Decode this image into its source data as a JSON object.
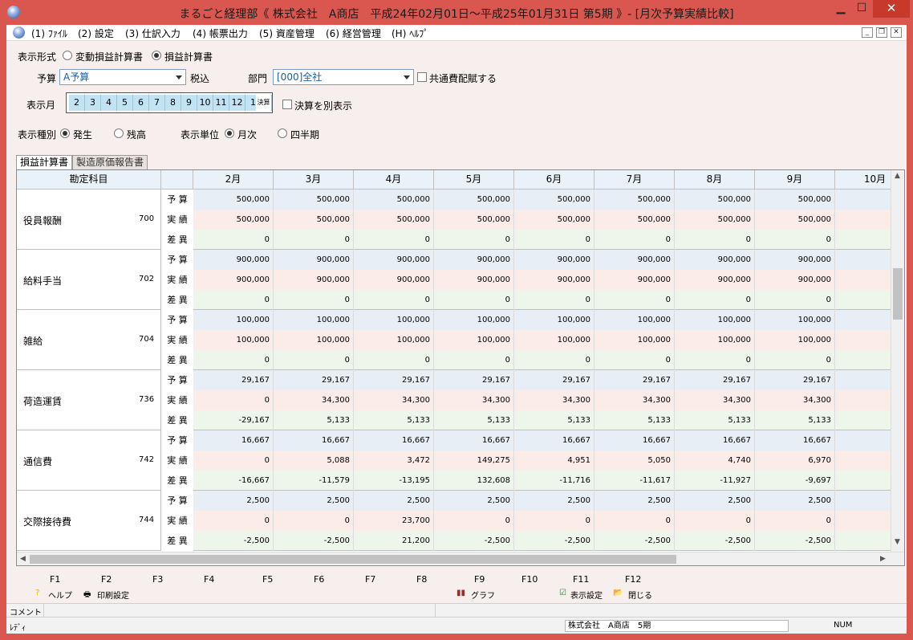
{
  "window": {
    "title": "まるごと経理部《 株式会社　A商店　平成24年02月01日～平成25年01月31日 第5期 》- [月次予算実績比較]",
    "min": "▁",
    "max": "☐",
    "close": "✕"
  },
  "menu": [
    {
      "label": "(1) ﾌｧｲﾙ"
    },
    {
      "label": "(2) 設定"
    },
    {
      "label": "(3) 仕訳入力"
    },
    {
      "label": "(4) 帳票出力"
    },
    {
      "label": "(5) 資産管理"
    },
    {
      "label": "(6) 経営管理"
    },
    {
      "label": "(H) ﾍﾙﾌﾟ"
    }
  ],
  "mdi": {
    "min": "_",
    "restore": "❐",
    "close": "✕"
  },
  "options": {
    "format_label": "表示形式",
    "format_opt1": "変動損益計算書",
    "format_opt2": "損益計算書",
    "format_selected": 2,
    "budget_label": "予算",
    "budget_value": "A予算",
    "tax_label": "税込",
    "dept_label": "部門",
    "dept_value": "[000]全社",
    "common_cost_label": "共通費配賦する",
    "month_label": "表示月",
    "months": [
      "2",
      "3",
      "4",
      "5",
      "6",
      "7",
      "8",
      "9",
      "10",
      "11",
      "12",
      "1"
    ],
    "kessan": "決算",
    "kessan_separate_label": "決算を別表示",
    "kind_label": "表示種別",
    "kind_opt1": "発生",
    "kind_opt2": "残高",
    "unit_label": "表示単位",
    "unit_opt1": "月次",
    "unit_opt2": "四半期"
  },
  "tabs": [
    {
      "label": "損益計算書",
      "active": true
    },
    {
      "label": "製造原価報告書",
      "active": false
    }
  ],
  "table": {
    "header_account": "勘定科目",
    "months": [
      "2月",
      "3月",
      "4月",
      "5月",
      "6月",
      "7月",
      "8月",
      "9月",
      "10月"
    ],
    "row_types": [
      "予 算",
      "実 績",
      "差 異"
    ],
    "accounts": [
      {
        "name": "役員報酬",
        "code": "700",
        "budget": [
          "500,000",
          "500,000",
          "500,000",
          "500,000",
          "500,000",
          "500,000",
          "500,000",
          "500,000",
          "5"
        ],
        "actual": [
          "500,000",
          "500,000",
          "500,000",
          "500,000",
          "500,000",
          "500,000",
          "500,000",
          "500,000",
          "5"
        ],
        "diff": [
          "0",
          "0",
          "0",
          "0",
          "0",
          "0",
          "0",
          "0",
          ""
        ]
      },
      {
        "name": "給料手当",
        "code": "702",
        "budget": [
          "900,000",
          "900,000",
          "900,000",
          "900,000",
          "900,000",
          "900,000",
          "900,000",
          "900,000",
          "9"
        ],
        "actual": [
          "900,000",
          "900,000",
          "900,000",
          "900,000",
          "900,000",
          "900,000",
          "900,000",
          "900,000",
          "9"
        ],
        "diff": [
          "0",
          "0",
          "0",
          "0",
          "0",
          "0",
          "0",
          "0",
          ""
        ]
      },
      {
        "name": "雑給",
        "code": "704",
        "budget": [
          "100,000",
          "100,000",
          "100,000",
          "100,000",
          "100,000",
          "100,000",
          "100,000",
          "100,000",
          "1"
        ],
        "actual": [
          "100,000",
          "100,000",
          "100,000",
          "100,000",
          "100,000",
          "100,000",
          "100,000",
          "100,000",
          "1"
        ],
        "diff": [
          "0",
          "0",
          "0",
          "0",
          "0",
          "0",
          "0",
          "0",
          ""
        ]
      },
      {
        "name": "荷造運賃",
        "code": "736",
        "budget": [
          "29,167",
          "29,167",
          "29,167",
          "29,167",
          "29,167",
          "29,167",
          "29,167",
          "29,167",
          ""
        ],
        "actual": [
          "0",
          "34,300",
          "34,300",
          "34,300",
          "34,300",
          "34,300",
          "34,300",
          "34,300",
          ""
        ],
        "diff": [
          "-29,167",
          "5,133",
          "5,133",
          "5,133",
          "5,133",
          "5,133",
          "5,133",
          "5,133",
          ""
        ]
      },
      {
        "name": "通信費",
        "code": "742",
        "budget": [
          "16,667",
          "16,667",
          "16,667",
          "16,667",
          "16,667",
          "16,667",
          "16,667",
          "16,667",
          ""
        ],
        "actual": [
          "0",
          "5,088",
          "3,472",
          "149,275",
          "4,951",
          "5,050",
          "4,740",
          "6,970",
          ""
        ],
        "diff": [
          "-16,667",
          "-11,579",
          "-13,195",
          "132,608",
          "-11,716",
          "-11,617",
          "-11,927",
          "-9,697",
          "-"
        ]
      },
      {
        "name": "交際接待費",
        "code": "744",
        "budget": [
          "2,500",
          "2,500",
          "2,500",
          "2,500",
          "2,500",
          "2,500",
          "2,500",
          "2,500",
          ""
        ],
        "actual": [
          "0",
          "0",
          "23,700",
          "0",
          "0",
          "0",
          "0",
          "0",
          ""
        ],
        "diff": [
          "-2,500",
          "-2,500",
          "21,200",
          "-2,500",
          "-2,500",
          "-2,500",
          "-2,500",
          "-2,500",
          "-"
        ]
      }
    ]
  },
  "function_keys": {
    "keys": [
      "F1",
      "F2",
      "F3",
      "F4",
      "F5",
      "F6",
      "F7",
      "F8",
      "F9",
      "F10",
      "F11",
      "F12"
    ],
    "f1_label": "ヘルプ",
    "f2_label": "印刷設定",
    "f9_label": "グラフ",
    "f11_label": "表示設定",
    "f12_label": "閉じる"
  },
  "status": {
    "comment_label": "コメント",
    "ready": "ﾚﾃﾞｨ",
    "company": "株式会社　A商店　5期",
    "num": "NUM"
  }
}
